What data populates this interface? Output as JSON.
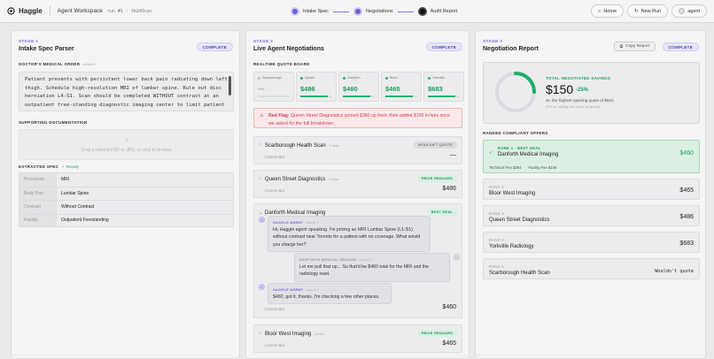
{
  "header": {
    "app_name": "Haggle",
    "workspace": "Agent Workspace",
    "run_id": "run #1 · fb243cec",
    "steps": [
      "Intake Spec",
      "Negotiations",
      "Audit Report"
    ],
    "buttons": {
      "home": "Home",
      "new_run": "New Run",
      "user": "agent"
    }
  },
  "stage1": {
    "stage_label": "STAGE 1",
    "title": "Intake Spec Parser",
    "status": "COMPLETE",
    "order_label": "DOCTOR'S MEDICAL ORDER",
    "order_sub": "editable",
    "order_text": "Patient presents with persistent lower back pain radiating down left thigh. Schedule high-resolution MRI of lumbar spine. Rule out disc herniation L4-S1. Scan should be completed WITHOUT contrast at an outpatient free-standing diagnostic imaging center to limit patient out-of-pocket exposure.",
    "docs_label": "SUPPORTING DOCUMENTATION",
    "upload_text": "Drop a referral PDF or JPG, or click to browse",
    "extracted_label": "EXTRACTED SPEC",
    "ready": "✓ Ready",
    "spec": [
      {
        "k": "Procedure",
        "v": "MRI"
      },
      {
        "k": "Body Part",
        "v": "Lumbar Spine"
      },
      {
        "k": "Contrast",
        "v": "Without Contrast"
      },
      {
        "k": "Facility",
        "v": "Outpatient Freestanding"
      }
    ]
  },
  "stage2": {
    "stage_label": "STAGE 2",
    "title": "Live Agent Negotiations",
    "status": "COMPLETE",
    "board_label": "REALTIME QUOTE BOARD",
    "quotes": [
      {
        "name": "Scarborough",
        "price": "—",
        "progress": 0
      },
      {
        "name": "Queen",
        "price": "$486",
        "progress": 0.85
      },
      {
        "name": "Danforth",
        "price": "$460",
        "progress": 0.85
      },
      {
        "name": "Bloor",
        "price": "$465",
        "progress": 0.85
      },
      {
        "name": "Yorkville",
        "price": "$683",
        "progress": 0.85
      }
    ],
    "flag_title": "Red Flag:",
    "flag_text": "Queen Street Diagnostics quoted $380 up front, then added $106 in fees once we asked for the full breakdown.",
    "current_bid_label": "Current Bid",
    "cards": [
      {
        "name": "Scarborough Health Scan",
        "count": "2 lines",
        "tag": "WOULDN'T QUOTE",
        "bid": "—"
      },
      {
        "name": "Queen Street Diagnostics",
        "count": "6 lines",
        "tag": "PRICE REDUCED",
        "bid": "$486"
      },
      {
        "name": "Danforth Medical Imaging",
        "count": "",
        "tag": "BEST DEAL",
        "bid": "$460"
      },
      {
        "name": "Bloor West Imaging",
        "count": "6 lines",
        "tag": "PRICE REDUCED",
        "bid": "$465"
      }
    ],
    "messages": [
      {
        "who": "HAGGLE AGENT",
        "round": "round 1",
        "text": "Hi, Haggle agent speaking. I'm pricing an MRI Lumbar Spine (L1-S1) without contrast near Toronto for a patient with no coverage. What would you charge her?"
      },
      {
        "who": "DANFORTH MEDICAL IMAGING",
        "round": "round 1",
        "text": "Let me pull that up... So that'd be $460 total for the MRI and the radiology read."
      },
      {
        "who": "HAGGLE AGENT",
        "round": "round 1",
        "text": "$460, got it, thanks. I'm checking a few other places."
      }
    ]
  },
  "stage3": {
    "stage_label": "STAGE 3",
    "title": "Negotiation Report",
    "copy": "Copy Report",
    "status": "COMPLETE",
    "savings_label": "TOTAL NEGOTIATED SAVINGS",
    "savings_value": "$150",
    "savings_pct": "-25%",
    "savings_fraction": 0.25,
    "savings_line1": "vs. the highest opening quote of $610",
    "savings_line2": "$75 vs. calling one clinic at random",
    "ranked_label": "RANKED COMPLIANT OFFERS",
    "best": {
      "rank": "RANK 1 · BEST DEAL",
      "name": "Danforth Medical Imaging",
      "price": "$460",
      "fee1": "Technical Fee $354",
      "fee2": "Facility Fee $106"
    },
    "ranks": [
      {
        "rank": "RANK 2",
        "name": "Bloor West Imaging",
        "price": "$465"
      },
      {
        "rank": "RANK 3",
        "name": "Queen Street Diagnostics",
        "price": "$486"
      },
      {
        "rank": "RANK 4",
        "name": "Yorkville Radiology",
        "price": "$683"
      },
      {
        "rank": "RANK 5",
        "name": "Scarborough Health Scan",
        "price": "Wouldn't quote"
      }
    ]
  }
}
